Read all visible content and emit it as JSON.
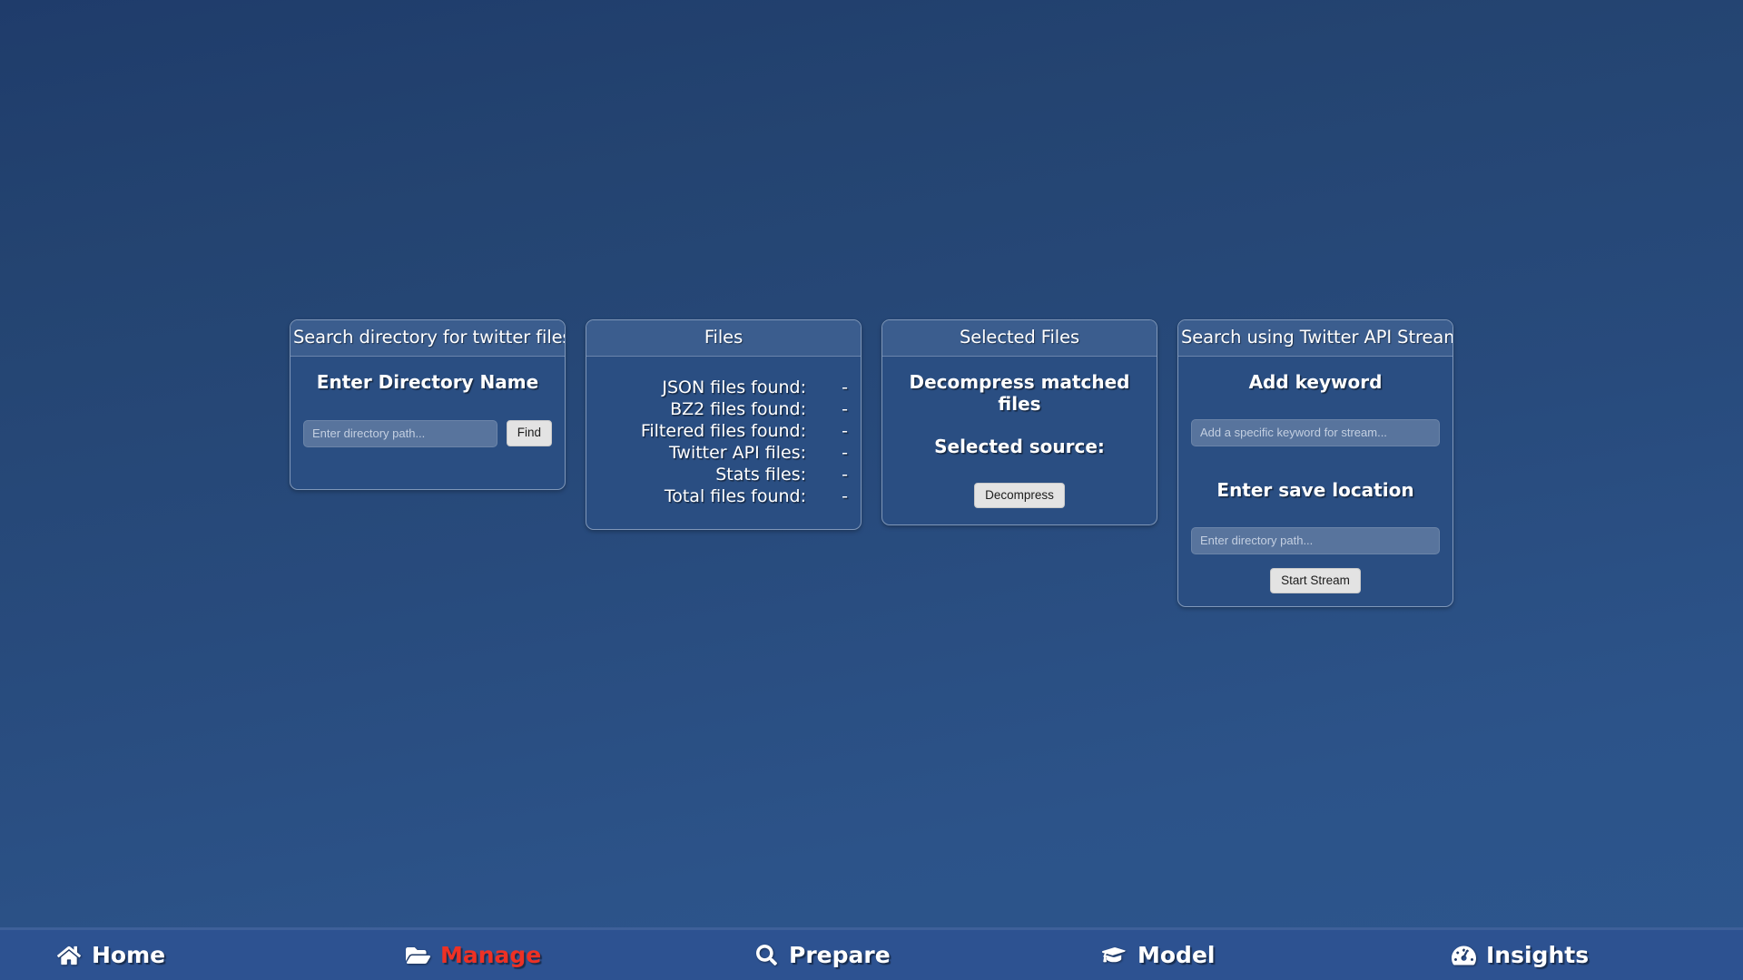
{
  "cards": {
    "search": {
      "header": "Search directory for twitter files",
      "title": "Enter Directory Name",
      "input_placeholder": "Enter directory path...",
      "input_value": "",
      "find_label": "Find"
    },
    "files": {
      "header": "Files",
      "rows": [
        {
          "label": "JSON files found:",
          "value": "-"
        },
        {
          "label": "BZ2 files found:",
          "value": "-"
        },
        {
          "label": "Filtered files found:",
          "value": "-"
        },
        {
          "label": "Twitter API files:",
          "value": "-"
        },
        {
          "label": "Stats files:",
          "value": "-"
        },
        {
          "label": "Total files found:",
          "value": "-"
        }
      ]
    },
    "selected": {
      "header": "Selected Files",
      "title": "Decompress matched files",
      "source_label": "Selected source:",
      "decompress_label": "Decompress"
    },
    "stream": {
      "header": "Search using Twitter API Stream",
      "keyword_title": "Add keyword",
      "keyword_placeholder": "Add a specific keyword for stream...",
      "keyword_value": "",
      "save_title": "Enter save location",
      "save_placeholder": "Enter directory path...",
      "save_value": "",
      "start_label": "Start Stream"
    }
  },
  "bottom_nav": {
    "items": [
      {
        "label": "Home",
        "icon": "home-icon",
        "active": false
      },
      {
        "label": "Manage",
        "icon": "folder-open-icon",
        "active": true
      },
      {
        "label": "Prepare",
        "icon": "search-icon",
        "active": false
      },
      {
        "label": "Model",
        "icon": "graduation-cap-icon",
        "active": false
      },
      {
        "label": "Insights",
        "icon": "tachometer-icon",
        "active": false
      }
    ]
  },
  "colors": {
    "background_top": "#1f3c6b",
    "background_bottom": "#2d568d",
    "card_body": "#2a4e82",
    "card_header": "#3b5d8e",
    "card_border": "#7f97b9",
    "nav_background": "#2d5291",
    "nav_active_text": "#ee3124",
    "button_background": "#e3e3e3",
    "text": "#ffffff"
  }
}
